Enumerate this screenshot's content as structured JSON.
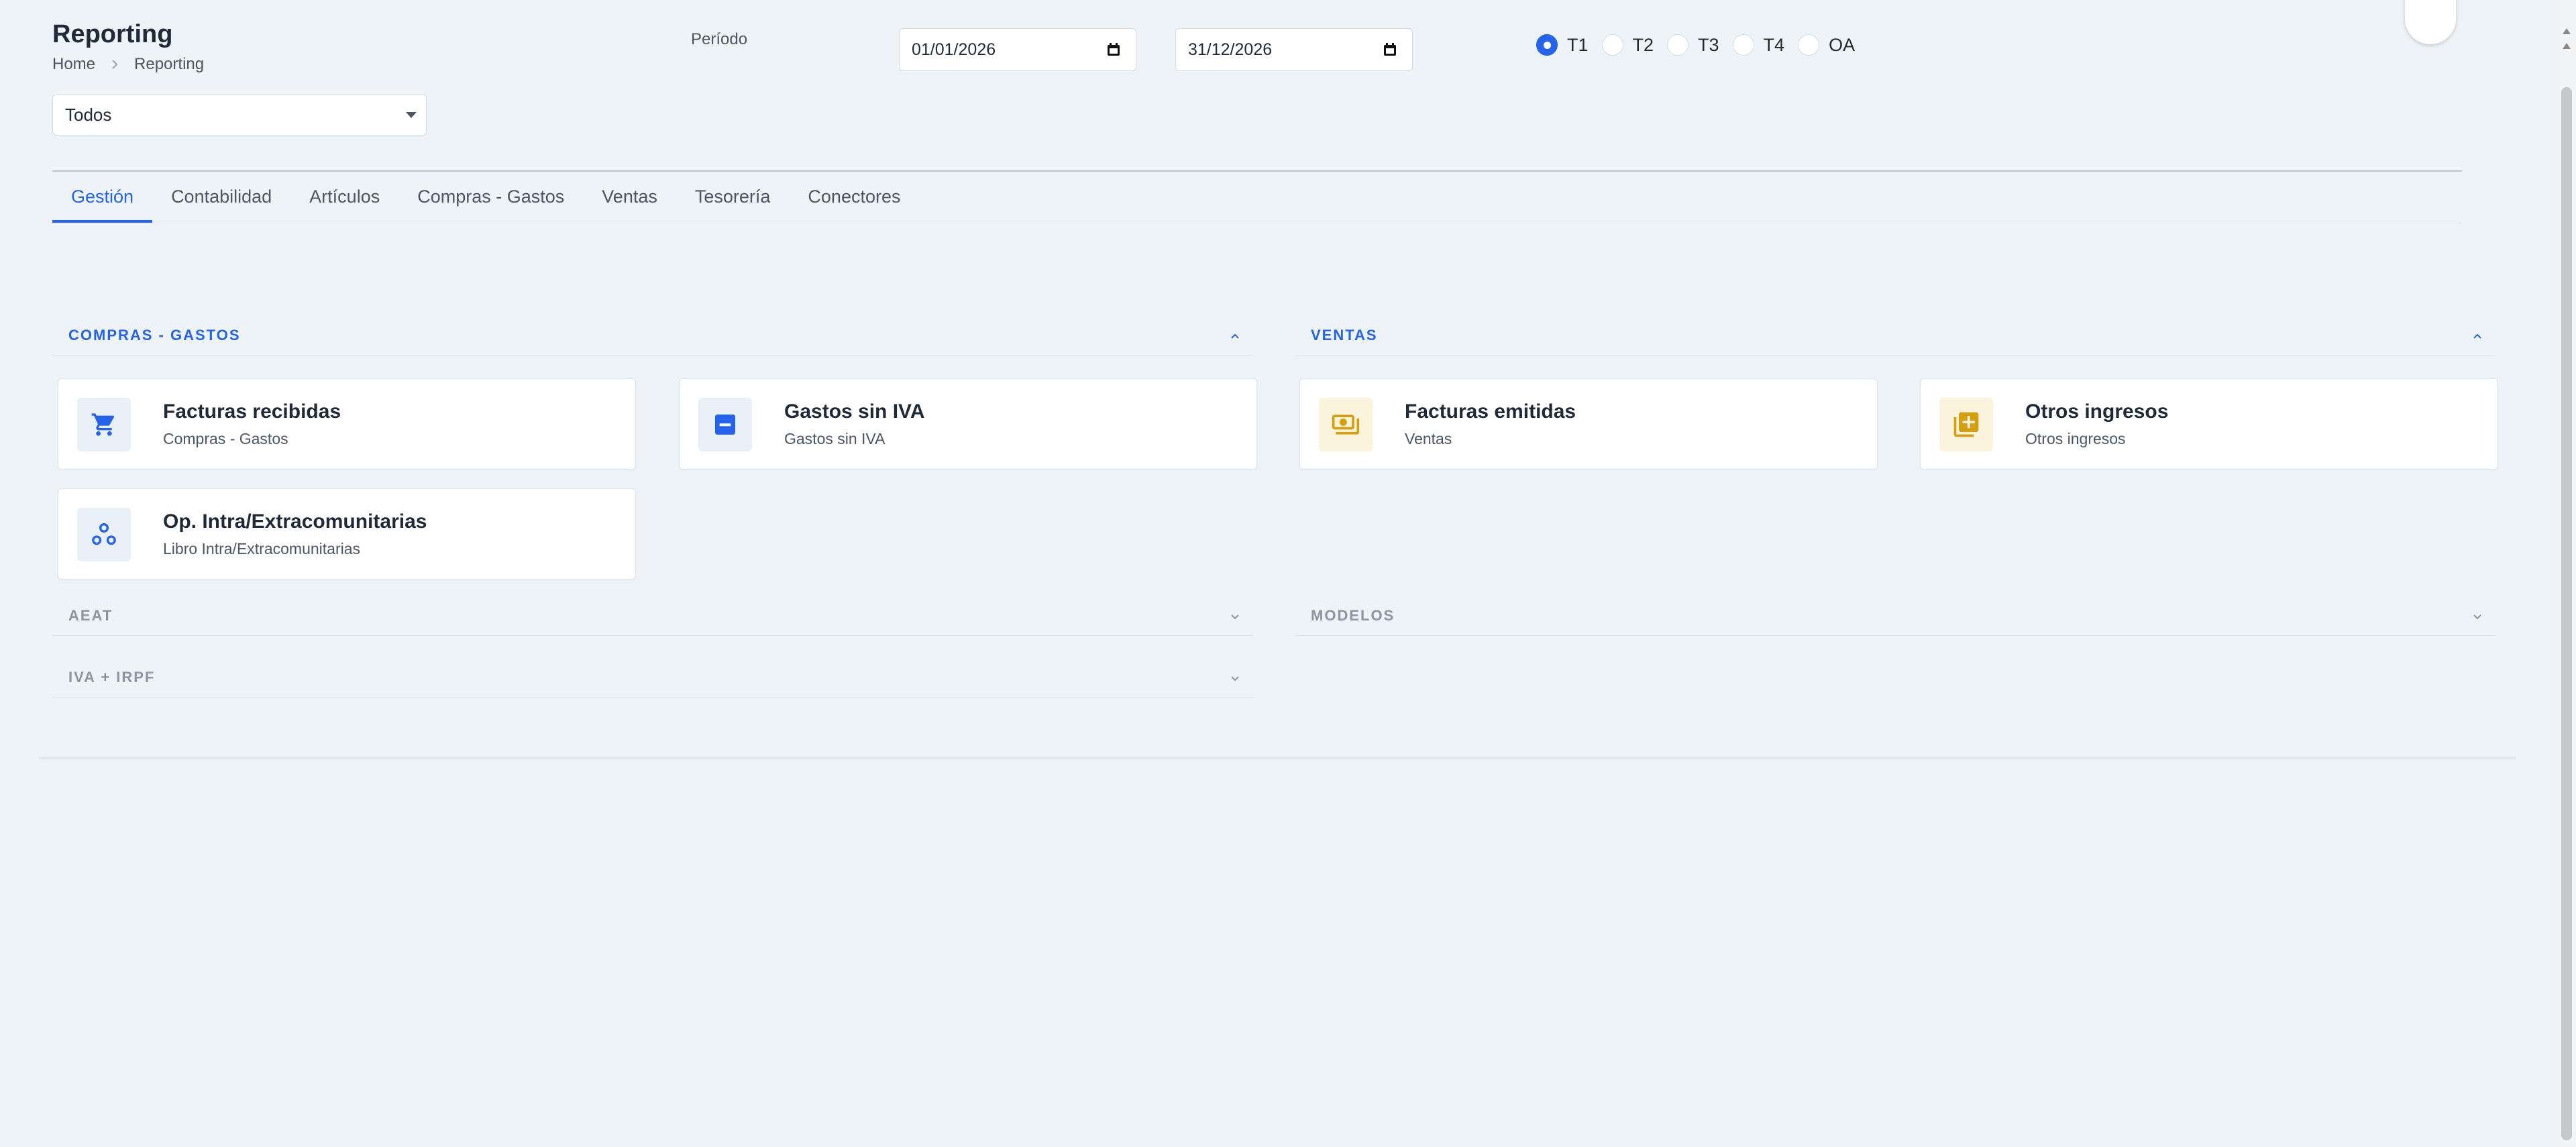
{
  "header": {
    "title": "Reporting",
    "breadcrumb": [
      "Home",
      "Reporting"
    ]
  },
  "filter": {
    "selected": "Todos"
  },
  "period": {
    "label": "Período",
    "from": "01/01/2026",
    "to": "31/12/2026",
    "options": [
      "T1",
      "T2",
      "T3",
      "T4",
      "OA"
    ],
    "selected": "T1"
  },
  "tabs": [
    "Gestión",
    "Contabilidad",
    "Artículos",
    "Compras - Gastos",
    "Ventas",
    "Tesorería",
    "Conectores"
  ],
  "active_tab": "Gestión",
  "sections": {
    "compras": {
      "title": "COMPRAS - GASTOS",
      "expanded": true,
      "cards": [
        {
          "title": "Facturas recibidas",
          "subtitle": "Compras - Gastos",
          "icon": "cart-icon"
        },
        {
          "title": "Gastos sin IVA",
          "subtitle": "Gastos sin IVA",
          "icon": "minus-square-icon"
        },
        {
          "title": "Op. Intra/Extracomunitarias",
          "subtitle": "Libro Intra/Extracomunitarias",
          "icon": "hub-icon"
        }
      ]
    },
    "ventas": {
      "title": "VENTAS",
      "expanded": true,
      "cards": [
        {
          "title": "Facturas emitidas",
          "subtitle": "Ventas",
          "icon": "money-icon"
        },
        {
          "title": "Otros ingresos",
          "subtitle": "Otros ingresos",
          "icon": "add-box-icon"
        }
      ]
    },
    "aeat": {
      "title": "AEAT",
      "expanded": false
    },
    "modelos": {
      "title": "MODELOS",
      "expanded": false
    },
    "iva": {
      "title": "IVA + IRPF",
      "expanded": false
    }
  },
  "colors": {
    "accent": "#2563eb",
    "icon_yellow": "#d59f12",
    "background": "#eef3f7"
  }
}
